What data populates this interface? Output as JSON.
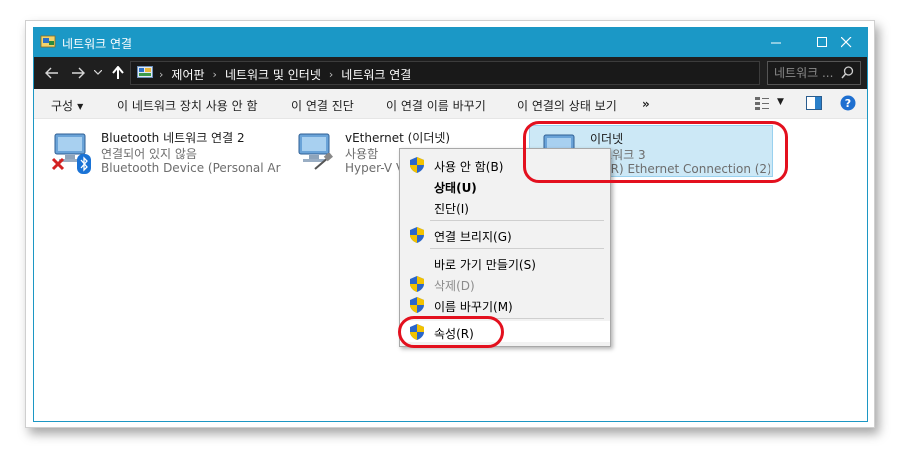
{
  "window": {
    "title": "네트워크 연결"
  },
  "address": {
    "crumbs": [
      "제어판",
      "네트워크 및 인터넷",
      "네트워크 연결"
    ],
    "search_placeholder": "네트워크 ..."
  },
  "toolbar": {
    "organize": "구성",
    "disable": "이 네트워크 장치 사용 안 함",
    "diagnose": "이 연결 진단",
    "rename": "이 연결 이름 바꾸기",
    "status": "이 연결의 상태 보기",
    "more": "»"
  },
  "connections": [
    {
      "name": "Bluetooth 네트워크 연결 2",
      "status": "연결되어 있지 않음",
      "device": "Bluetooth Device (Personal Area ..."
    },
    {
      "name": "vEthernet (이더넷)",
      "status": "사용함",
      "device": "Hyper-V V"
    },
    {
      "name": "이더넷",
      "status": "네트워크  3",
      "device": "(R) Ethernet Connection (2) I..."
    }
  ],
  "context_menu": {
    "disable": "사용 안 함(B)",
    "status": "상태(U)",
    "diagnose": "진단(I)",
    "bridge": "연결 브리지(G)",
    "shortcut": "바로 가기 만들기(S)",
    "delete": "삭제(D)",
    "rename": "이름 바꾸기(M)",
    "properties": "속성(R)"
  },
  "colors": {
    "titlebar": "#1b98c6",
    "addressbar": "#1f1f1f",
    "selection": "#cce8f6",
    "annotation": "#e3101e"
  }
}
